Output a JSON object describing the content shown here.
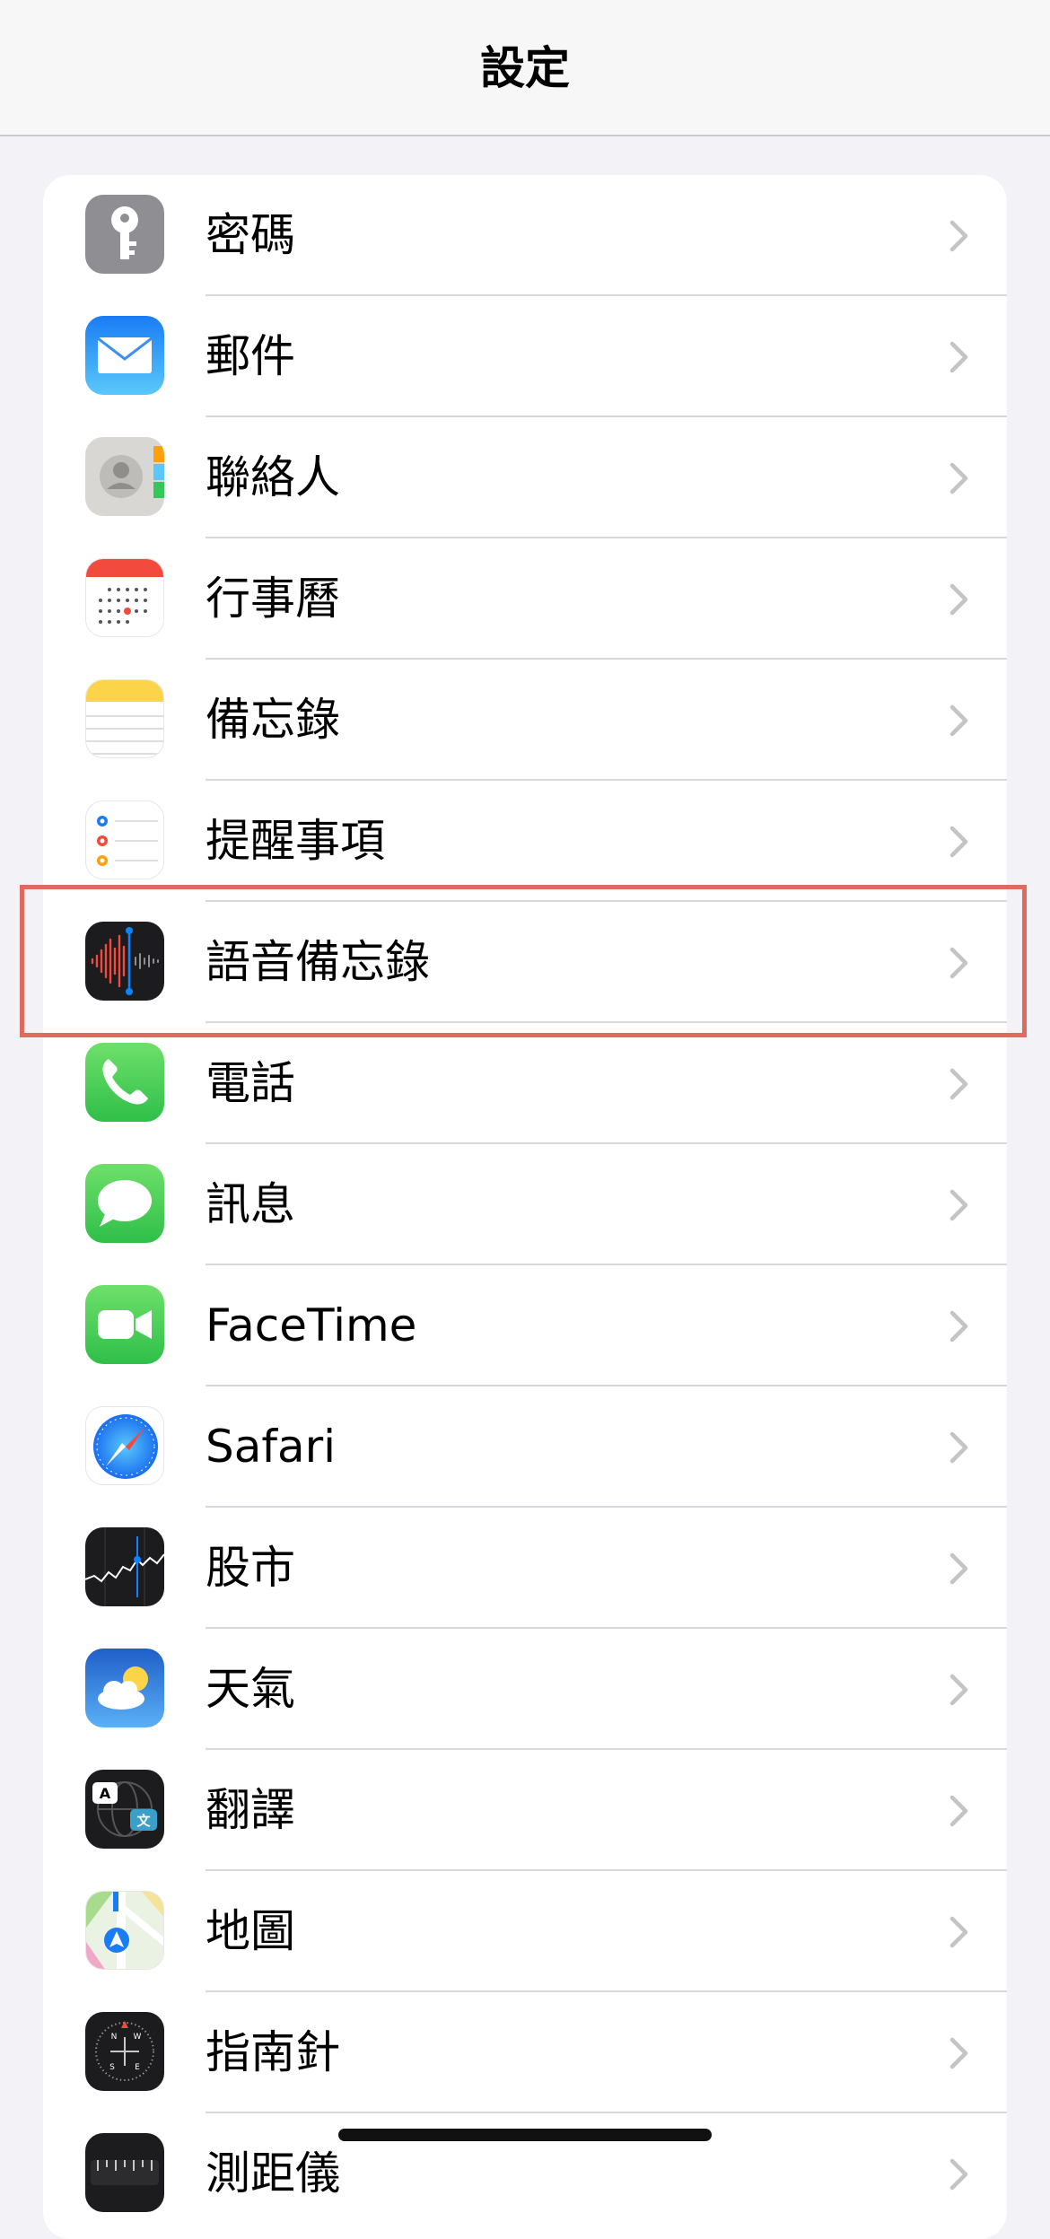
{
  "nav": {
    "title": "設定"
  },
  "rows": [
    {
      "label": "密碼",
      "icon": "key-icon"
    },
    {
      "label": "郵件",
      "icon": "mail-icon"
    },
    {
      "label": "聯絡人",
      "icon": "contacts-icon"
    },
    {
      "label": "行事曆",
      "icon": "calendar-icon"
    },
    {
      "label": "備忘錄",
      "icon": "notes-icon"
    },
    {
      "label": "提醒事項",
      "icon": "reminders-icon"
    },
    {
      "label": "語音備忘錄",
      "icon": "voice-memos-icon"
    },
    {
      "label": "電話",
      "icon": "phone-icon"
    },
    {
      "label": "訊息",
      "icon": "messages-icon"
    },
    {
      "label": "FaceTime",
      "icon": "facetime-icon"
    },
    {
      "label": "Safari",
      "icon": "safari-icon"
    },
    {
      "label": "股市",
      "icon": "stocks-icon"
    },
    {
      "label": "天氣",
      "icon": "weather-icon"
    },
    {
      "label": "翻譯",
      "icon": "translate-icon"
    },
    {
      "label": "地圖",
      "icon": "maps-icon"
    },
    {
      "label": "指南針",
      "icon": "compass-icon"
    },
    {
      "label": "測距儀",
      "icon": "measure-icon"
    }
  ],
  "translate_icon": {
    "glyph_a": "A",
    "glyph_zh": "文"
  },
  "compass_icon": {
    "n": "N",
    "e": "E",
    "s": "S",
    "w": "W"
  },
  "colors": {
    "highlight": "#e06a5d",
    "background": "#f2f2f7"
  }
}
